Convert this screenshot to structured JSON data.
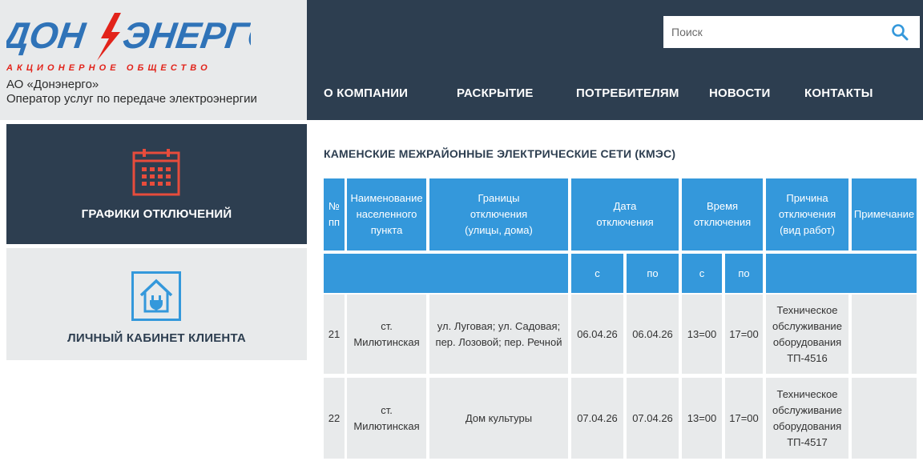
{
  "brand": {
    "logo_text": "ДОН ЭНЕРГО",
    "logo_subtitle": "АКЦИОНЕРНОЕ ОБЩЕСТВО",
    "org_name": "АО «Донэнерго»",
    "org_description": "Оператор услуг по передаче электроэнергии",
    "colors": {
      "navy": "#2d3e50",
      "red": "#e2231a",
      "blue": "#2f73b8",
      "table_header": "#3498db",
      "panel_light": "#e8eaeb"
    }
  },
  "search": {
    "placeholder": "Поиск",
    "value": "",
    "icon": "search-icon"
  },
  "nav": {
    "items": [
      {
        "label": "О КОМПАНИИ"
      },
      {
        "label": "РАСКРЫТИЕ"
      },
      {
        "label": "ПОТРЕБИТЕЛЯМ"
      },
      {
        "label": "НОВОСТИ"
      },
      {
        "label": "КОНТАКТЫ"
      }
    ]
  },
  "sidebar": {
    "schedules": {
      "label": "ГРАФИКИ ОТКЛЮЧЕНИЙ",
      "icon": "calendar-icon"
    },
    "account": {
      "label": "ЛИЧНЫЙ КАБИНЕТ КЛИЕНТА",
      "icon": "house-plug-icon"
    }
  },
  "main": {
    "title": "КАМЕНСКИЕ МЕЖРАЙОННЫЕ ЭЛЕКТРИЧЕСКИЕ СЕТИ (КМЭС)",
    "table": {
      "headers": {
        "num": "№ пп",
        "locality": "Наименование населенного пункта",
        "bounds": "Границы отключения (улицы, дома)",
        "date": "Дата отключения",
        "time": "Время отключения",
        "reason": "Причина отключения (вид работ)",
        "note": "Примечание"
      },
      "subheaders": {
        "date_from": "с",
        "date_to": "по",
        "time_from": "с",
        "time_to": "по"
      },
      "rows": [
        {
          "num": "21",
          "locality": "ст. Милютинская",
          "bounds": "ул. Луговая; ул. Садовая; пер. Лозовой; пер. Речной",
          "date_from": "06.04.26",
          "date_to": "06.04.26",
          "time_from": "13=00",
          "time_to": "17=00",
          "reason": "Техническое обслуживание оборудования ТП-4516",
          "note": ""
        },
        {
          "num": "22",
          "locality": "ст. Милютинская",
          "bounds": "Дом культуры",
          "date_from": "07.04.26",
          "date_to": "07.04.26",
          "time_from": "13=00",
          "time_to": "17=00",
          "reason": "Техническое обслуживание оборудования ТП-4517",
          "note": ""
        }
      ]
    }
  }
}
